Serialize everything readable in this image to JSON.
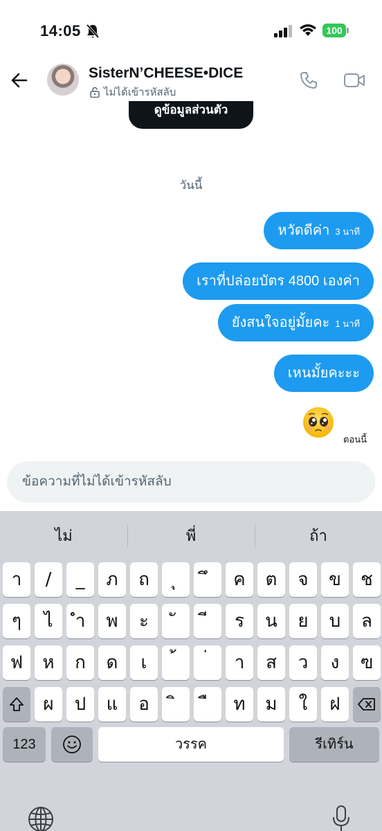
{
  "status": {
    "time": "14:05",
    "battery": "100"
  },
  "header": {
    "name": "SisterN’CHEESE•DICE",
    "encryption": "ไม่ได้เข้ารหัสลับ"
  },
  "profile_button": "ดูข้อมูลส่วนตัว",
  "date_label": "วันนี้",
  "messages": [
    {
      "text": "หวัดดีค่า",
      "time": "3 นาที"
    },
    {
      "text": "เราที่ปล่อยบัตร 4800 เองค่า",
      "time": ""
    },
    {
      "text": "ยังสนใจอยู่มั้ยคะ",
      "time": "1 นาที"
    },
    {
      "text": "เหนมั้ยคะะะ",
      "time": ""
    }
  ],
  "last_emoji": "pleading-face",
  "now_label": "ตอนนี้",
  "composer": {
    "placeholder": "ข้อความที่ไม่ได้เข้ารหัสลับ"
  },
  "keyboard": {
    "suggestions": [
      "ไม่",
      "พี่",
      "ถ้า"
    ],
    "row1": [
      "า",
      "/",
      "_",
      "ภ",
      "ถ",
      "ุ",
      "ึ",
      "ค",
      "ต",
      "จ",
      "ข",
      "ช"
    ],
    "row2": [
      "ๆ",
      "ไ",
      "ำ",
      "พ",
      "ะ",
      "ั",
      "ี",
      "ร",
      "น",
      "ย",
      "บ",
      "ล"
    ],
    "row3": [
      "ฟ",
      "ห",
      "ก",
      "ด",
      "เ",
      "้",
      "่",
      "า",
      "ส",
      "ว",
      "ง",
      "ฃ"
    ],
    "row4": [
      "ผ",
      "ป",
      "แ",
      "อ",
      "ิ",
      "ื",
      "ท",
      "ม",
      "ใ",
      "ฝ"
    ],
    "numbers_key": "123",
    "space_key": "วรรค",
    "return_key": "รีเทิร์น"
  },
  "colors": {
    "bubble": "#1d9bf0",
    "battery": "#34c759",
    "keyboard_bg": "#d1d5db"
  }
}
